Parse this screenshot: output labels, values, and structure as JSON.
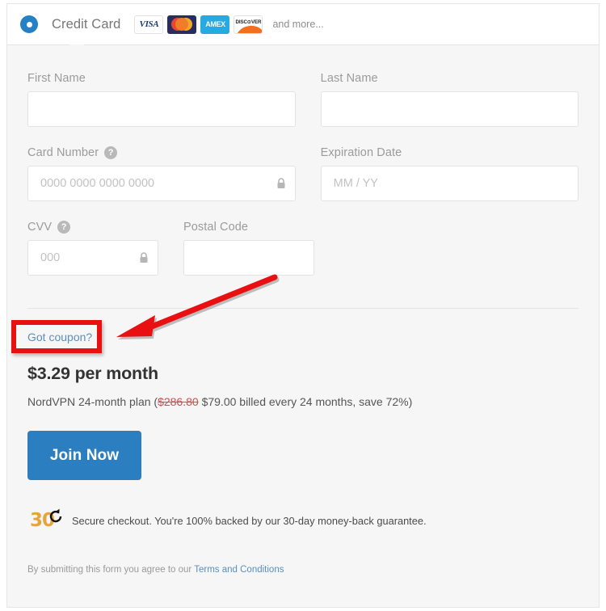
{
  "payment_method": {
    "label": "Credit Card",
    "selected": true,
    "radio_icon": "radio-selected-icon",
    "card_brands": [
      {
        "name": "visa",
        "text": "VISA"
      },
      {
        "name": "mastercard",
        "text": ""
      },
      {
        "name": "amex",
        "text": "AMEX"
      },
      {
        "name": "discover",
        "text": "DISC⊙VER"
      }
    ],
    "and_more": "and more..."
  },
  "form": {
    "first_name": {
      "label": "First Name",
      "value": "",
      "placeholder": ""
    },
    "last_name": {
      "label": "Last Name",
      "value": "",
      "placeholder": ""
    },
    "card_number": {
      "label": "Card Number",
      "value": "",
      "placeholder": "0000 0000 0000 0000",
      "help_icon": "question-mark-icon",
      "help_glyph": "?",
      "lock_icon": "lock-icon"
    },
    "expiration": {
      "label": "Expiration Date",
      "value": "",
      "placeholder": "MM / YY"
    },
    "cvv": {
      "label": "CVV",
      "value": "",
      "placeholder": "000",
      "help_icon": "question-mark-icon",
      "help_glyph": "?",
      "lock_icon": "lock-icon"
    },
    "postal_code": {
      "label": "Postal Code",
      "value": "",
      "placeholder": ""
    }
  },
  "coupon": {
    "link_text": "Got coupon?"
  },
  "pricing": {
    "headline": "$3.29 per month",
    "plan_prefix": "NordVPN 24-month plan (",
    "old_price": "$286.80",
    "details": " $79.00 billed every 24 months, save 72%)"
  },
  "cta": {
    "label": "Join Now"
  },
  "guarantee": {
    "badge_number": "30",
    "badge_icon": "refresh-arrow-icon",
    "text": "Secure checkout. You're 100% backed by our 30-day money-back guarantee."
  },
  "footer": {
    "prefix": "By submitting this form you agree to our ",
    "link_text": "Terms and Conditions"
  },
  "annotations": {
    "highlight_target": "Got coupon?",
    "arrow_color": "#e81010",
    "box_color": "#e81010"
  },
  "colors": {
    "accent_blue": "#2b7fc0",
    "link_blue": "#5a8fbd",
    "panel_bg": "#f6f6f6",
    "strike_red": "#d64b4b",
    "badge_orange": "#e8a33d"
  }
}
